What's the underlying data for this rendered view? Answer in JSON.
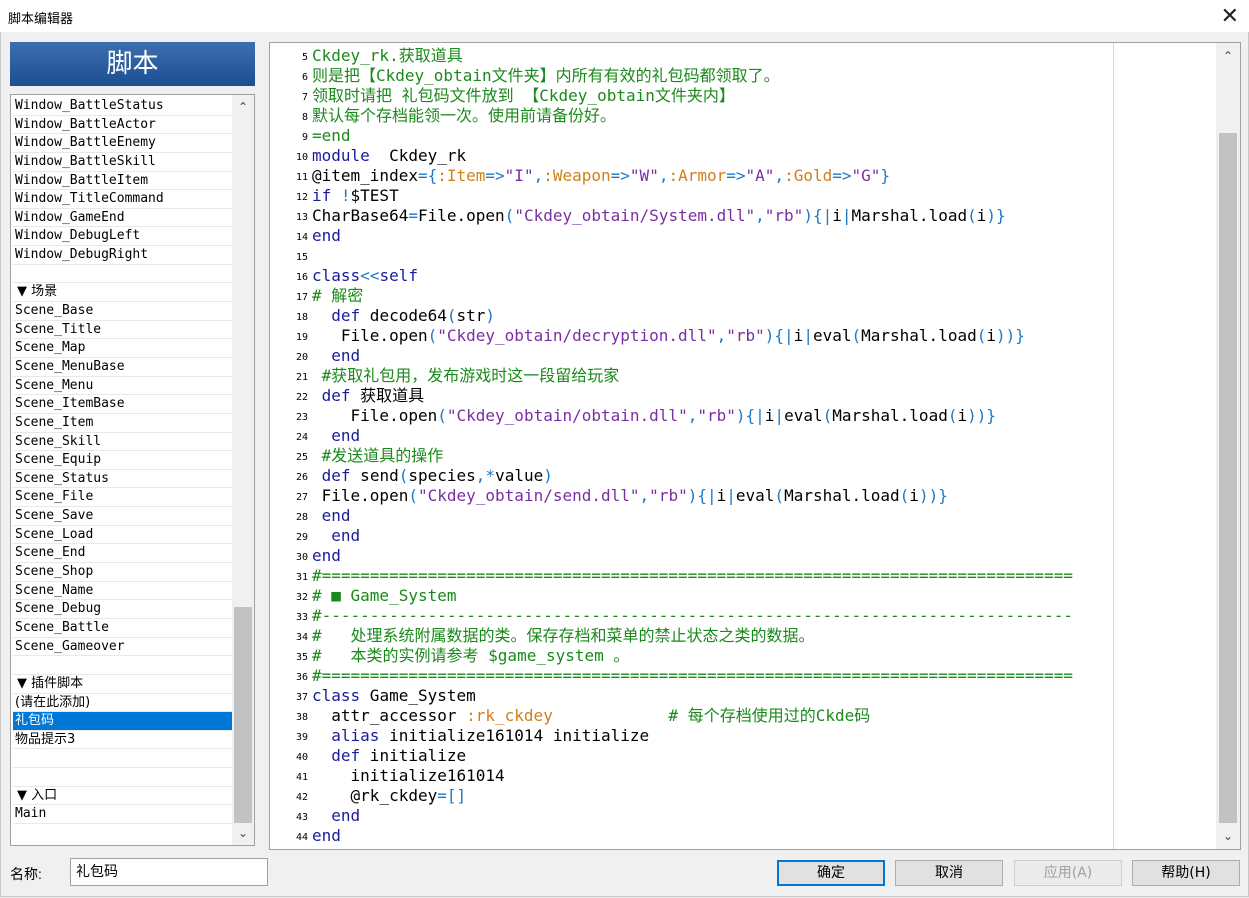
{
  "window": {
    "title": "脚本编辑器",
    "close_glyph": "✕"
  },
  "header": {
    "title": "脚本"
  },
  "list": {
    "items": [
      {
        "label": "Window_BattleStatus",
        "kind": "item"
      },
      {
        "label": "Window_BattleActor",
        "kind": "item"
      },
      {
        "label": "Window_BattleEnemy",
        "kind": "item"
      },
      {
        "label": "Window_BattleSkill",
        "kind": "item"
      },
      {
        "label": "Window_BattleItem",
        "kind": "item"
      },
      {
        "label": "Window_TitleCommand",
        "kind": "item"
      },
      {
        "label": "Window_GameEnd",
        "kind": "item"
      },
      {
        "label": "Window_DebugLeft",
        "kind": "item"
      },
      {
        "label": "Window_DebugRight",
        "kind": "item"
      },
      {
        "label": "",
        "kind": "empty"
      },
      {
        "label": "▼ 场景",
        "kind": "section"
      },
      {
        "label": "Scene_Base",
        "kind": "item"
      },
      {
        "label": "Scene_Title",
        "kind": "item"
      },
      {
        "label": "Scene_Map",
        "kind": "item"
      },
      {
        "label": "Scene_MenuBase",
        "kind": "item"
      },
      {
        "label": "Scene_Menu",
        "kind": "item"
      },
      {
        "label": "Scene_ItemBase",
        "kind": "item"
      },
      {
        "label": "Scene_Item",
        "kind": "item"
      },
      {
        "label": "Scene_Skill",
        "kind": "item"
      },
      {
        "label": "Scene_Equip",
        "kind": "item"
      },
      {
        "label": "Scene_Status",
        "kind": "item"
      },
      {
        "label": "Scene_File",
        "kind": "item"
      },
      {
        "label": "Scene_Save",
        "kind": "item"
      },
      {
        "label": "Scene_Load",
        "kind": "item"
      },
      {
        "label": "Scene_End",
        "kind": "item"
      },
      {
        "label": "Scene_Shop",
        "kind": "item"
      },
      {
        "label": "Scene_Name",
        "kind": "item"
      },
      {
        "label": "Scene_Debug",
        "kind": "item"
      },
      {
        "label": "Scene_Battle",
        "kind": "item"
      },
      {
        "label": "Scene_Gameover",
        "kind": "item"
      },
      {
        "label": "",
        "kind": "empty"
      },
      {
        "label": "▼ 插件脚本",
        "kind": "section"
      },
      {
        "label": "(请在此添加)",
        "kind": "cjk"
      },
      {
        "label": "礼包码",
        "kind": "selected"
      },
      {
        "label": "物品提示3",
        "kind": "cjk"
      },
      {
        "label": "",
        "kind": "empty"
      },
      {
        "label": "",
        "kind": "empty"
      },
      {
        "label": "▼ 入口",
        "kind": "section"
      },
      {
        "label": "Main",
        "kind": "item"
      }
    ]
  },
  "code_lines": [
    {
      "n": "5",
      "segs": [
        [
          "cm",
          "Ckdey_rk.获取道具"
        ]
      ]
    },
    {
      "n": "6",
      "segs": [
        [
          "cm",
          "则是把【Ckdey_obtain文件夹】内所有有效的礼包码都领取了。"
        ]
      ]
    },
    {
      "n": "7",
      "segs": [
        [
          "cm",
          "领取时请把 礼包码文件放到 【Ckdey_obtain文件夹内】"
        ]
      ]
    },
    {
      "n": "8",
      "segs": [
        [
          "cm",
          "默认每个存档能领一次。使用前请备份好。"
        ]
      ]
    },
    {
      "n": "9",
      "segs": [
        [
          "cm",
          "=end"
        ]
      ]
    },
    {
      "n": "10",
      "segs": [
        [
          "kw",
          "module"
        ],
        [
          "",
          "  Ckdey_rk"
        ]
      ]
    },
    {
      "n": "11",
      "segs": [
        [
          "",
          "@item_index"
        ],
        [
          "op",
          "={"
        ],
        [
          "sy",
          ":Item"
        ],
        [
          "op",
          "=>"
        ],
        [
          "st",
          "\"I\""
        ],
        [
          "op",
          ","
        ],
        [
          "sy",
          ":Weapon"
        ],
        [
          "op",
          "=>"
        ],
        [
          "st",
          "\"W\""
        ],
        [
          "op",
          ","
        ],
        [
          "sy",
          ":Armor"
        ],
        [
          "op",
          "=>"
        ],
        [
          "st",
          "\"A\""
        ],
        [
          "op",
          ","
        ],
        [
          "sy",
          ":Gold"
        ],
        [
          "op",
          "=>"
        ],
        [
          "st",
          "\"G\""
        ],
        [
          "op",
          "}"
        ]
      ]
    },
    {
      "n": "12",
      "segs": [
        [
          "kw",
          "if"
        ],
        [
          "op",
          " !"
        ],
        [
          "",
          "$TEST"
        ]
      ]
    },
    {
      "n": "13",
      "segs": [
        [
          "",
          "CharBase64"
        ],
        [
          "op",
          "="
        ],
        [
          "",
          "File.open"
        ],
        [
          "op",
          "("
        ],
        [
          "st",
          "\"Ckdey_obtain/System.dll\""
        ],
        [
          "op",
          ","
        ],
        [
          "st",
          "\"rb\""
        ],
        [
          "op",
          ")"
        ],
        [
          "op",
          "{|"
        ],
        [
          "",
          "i"
        ],
        [
          "op",
          "|"
        ],
        [
          "",
          "Marshal.load"
        ],
        [
          "op",
          "("
        ],
        [
          "",
          "i"
        ],
        [
          "op",
          ")}"
        ]
      ]
    },
    {
      "n": "14",
      "segs": [
        [
          "kw",
          "end"
        ]
      ]
    },
    {
      "n": "15",
      "segs": [
        [
          "",
          ""
        ]
      ]
    },
    {
      "n": "16",
      "segs": [
        [
          "kw",
          "class"
        ],
        [
          "op",
          "<<"
        ],
        [
          "kw",
          "self"
        ]
      ]
    },
    {
      "n": "17",
      "segs": [
        [
          "cm",
          "# 解密"
        ]
      ]
    },
    {
      "n": "18",
      "segs": [
        [
          "",
          "  "
        ],
        [
          "kw",
          "def"
        ],
        [
          "",
          " decode64"
        ],
        [
          "op",
          "("
        ],
        [
          "",
          "str"
        ],
        [
          "op",
          ")"
        ]
      ]
    },
    {
      "n": "19",
      "segs": [
        [
          "",
          "   File.open"
        ],
        [
          "op",
          "("
        ],
        [
          "st",
          "\"Ckdey_obtain/decryption.dll\""
        ],
        [
          "op",
          ","
        ],
        [
          "st",
          "\"rb\""
        ],
        [
          "op",
          ")"
        ],
        [
          "op",
          "{|"
        ],
        [
          "",
          "i"
        ],
        [
          "op",
          "|"
        ],
        [
          "",
          "eval"
        ],
        [
          "op",
          "("
        ],
        [
          "",
          "Marshal.load"
        ],
        [
          "op",
          "("
        ],
        [
          "",
          "i"
        ],
        [
          "op",
          "))}"
        ]
      ]
    },
    {
      "n": "20",
      "segs": [
        [
          "",
          "  "
        ],
        [
          "kw",
          "end"
        ]
      ]
    },
    {
      "n": "21",
      "segs": [
        [
          "cm",
          " #获取礼包用，发布游戏时这一段留给玩家"
        ]
      ]
    },
    {
      "n": "22",
      "segs": [
        [
          "",
          " "
        ],
        [
          "kw",
          "def"
        ],
        [
          "",
          " 获取道具"
        ]
      ]
    },
    {
      "n": "23",
      "segs": [
        [
          "",
          "    File.open"
        ],
        [
          "op",
          "("
        ],
        [
          "st",
          "\"Ckdey_obtain/obtain.dll\""
        ],
        [
          "op",
          ","
        ],
        [
          "st",
          "\"rb\""
        ],
        [
          "op",
          ")"
        ],
        [
          "op",
          "{|"
        ],
        [
          "",
          "i"
        ],
        [
          "op",
          "|"
        ],
        [
          "",
          "eval"
        ],
        [
          "op",
          "("
        ],
        [
          "",
          "Marshal.load"
        ],
        [
          "op",
          "("
        ],
        [
          "",
          "i"
        ],
        [
          "op",
          "))}"
        ]
      ]
    },
    {
      "n": "24",
      "segs": [
        [
          "",
          "  "
        ],
        [
          "kw",
          "end"
        ]
      ]
    },
    {
      "n": "25",
      "segs": [
        [
          "cm",
          " #发送道具的操作"
        ]
      ]
    },
    {
      "n": "26",
      "segs": [
        [
          "",
          " "
        ],
        [
          "kw",
          "def"
        ],
        [
          "",
          " send"
        ],
        [
          "op",
          "("
        ],
        [
          "",
          "species"
        ],
        [
          "op",
          ",*"
        ],
        [
          "",
          "value"
        ],
        [
          "op",
          ")"
        ]
      ]
    },
    {
      "n": "27",
      "segs": [
        [
          "",
          " File.open"
        ],
        [
          "op",
          "("
        ],
        [
          "st",
          "\"Ckdey_obtain/send.dll\""
        ],
        [
          "op",
          ","
        ],
        [
          "st",
          "\"rb\""
        ],
        [
          "op",
          ")"
        ],
        [
          "op",
          "{|"
        ],
        [
          "",
          "i"
        ],
        [
          "op",
          "|"
        ],
        [
          "",
          "eval"
        ],
        [
          "op",
          "("
        ],
        [
          "",
          "Marshal.load"
        ],
        [
          "op",
          "("
        ],
        [
          "",
          "i"
        ],
        [
          "op",
          "))}"
        ]
      ]
    },
    {
      "n": "28",
      "segs": [
        [
          "",
          " "
        ],
        [
          "kw",
          "end"
        ]
      ]
    },
    {
      "n": "29",
      "segs": [
        [
          "",
          "  "
        ],
        [
          "kw",
          "end"
        ]
      ]
    },
    {
      "n": "30",
      "segs": [
        [
          "kw",
          "end"
        ]
      ]
    },
    {
      "n": "31",
      "segs": [
        [
          "cm",
          "#=============================================================================="
        ]
      ]
    },
    {
      "n": "32",
      "segs": [
        [
          "cm",
          "# ■ Game_System"
        ]
      ]
    },
    {
      "n": "33",
      "segs": [
        [
          "cm",
          "#------------------------------------------------------------------------------"
        ]
      ]
    },
    {
      "n": "34",
      "segs": [
        [
          "cm",
          "#   处理系统附属数据的类。保存存档和菜单的禁止状态之类的数据。"
        ]
      ]
    },
    {
      "n": "35",
      "segs": [
        [
          "cm",
          "#   本类的实例请参考 $game_system 。"
        ]
      ]
    },
    {
      "n": "36",
      "segs": [
        [
          "cm",
          "#=============================================================================="
        ]
      ]
    },
    {
      "n": "37",
      "segs": [
        [
          "kw",
          "class"
        ],
        [
          "",
          " Game_System"
        ]
      ]
    },
    {
      "n": "38",
      "segs": [
        [
          "",
          "  attr_accessor "
        ],
        [
          "sy",
          ":rk_ckdey"
        ],
        [
          "",
          "            "
        ],
        [
          "cm",
          "# 每个存档使用过的Ckde码"
        ]
      ]
    },
    {
      "n": "39",
      "segs": [
        [
          "",
          "  "
        ],
        [
          "kw",
          "alias"
        ],
        [
          "",
          " initialize161014 initialize"
        ]
      ]
    },
    {
      "n": "40",
      "segs": [
        [
          "",
          "  "
        ],
        [
          "kw",
          "def"
        ],
        [
          "",
          " initialize"
        ]
      ]
    },
    {
      "n": "41",
      "segs": [
        [
          "",
          "    initialize161014"
        ]
      ]
    },
    {
      "n": "42",
      "segs": [
        [
          "",
          "    @rk_ckdey"
        ],
        [
          "op",
          "=[]"
        ]
      ]
    },
    {
      "n": "43",
      "segs": [
        [
          "",
          "  "
        ],
        [
          "kw",
          "end"
        ]
      ]
    },
    {
      "n": "44",
      "segs": [
        [
          "kw",
          "end"
        ]
      ]
    }
  ],
  "footer": {
    "name_label": "名称:",
    "name_value": "礼包码",
    "ok_label": "确定",
    "cancel_label": "取消",
    "apply_label": "应用(A)",
    "help_label": "帮助(H)"
  }
}
